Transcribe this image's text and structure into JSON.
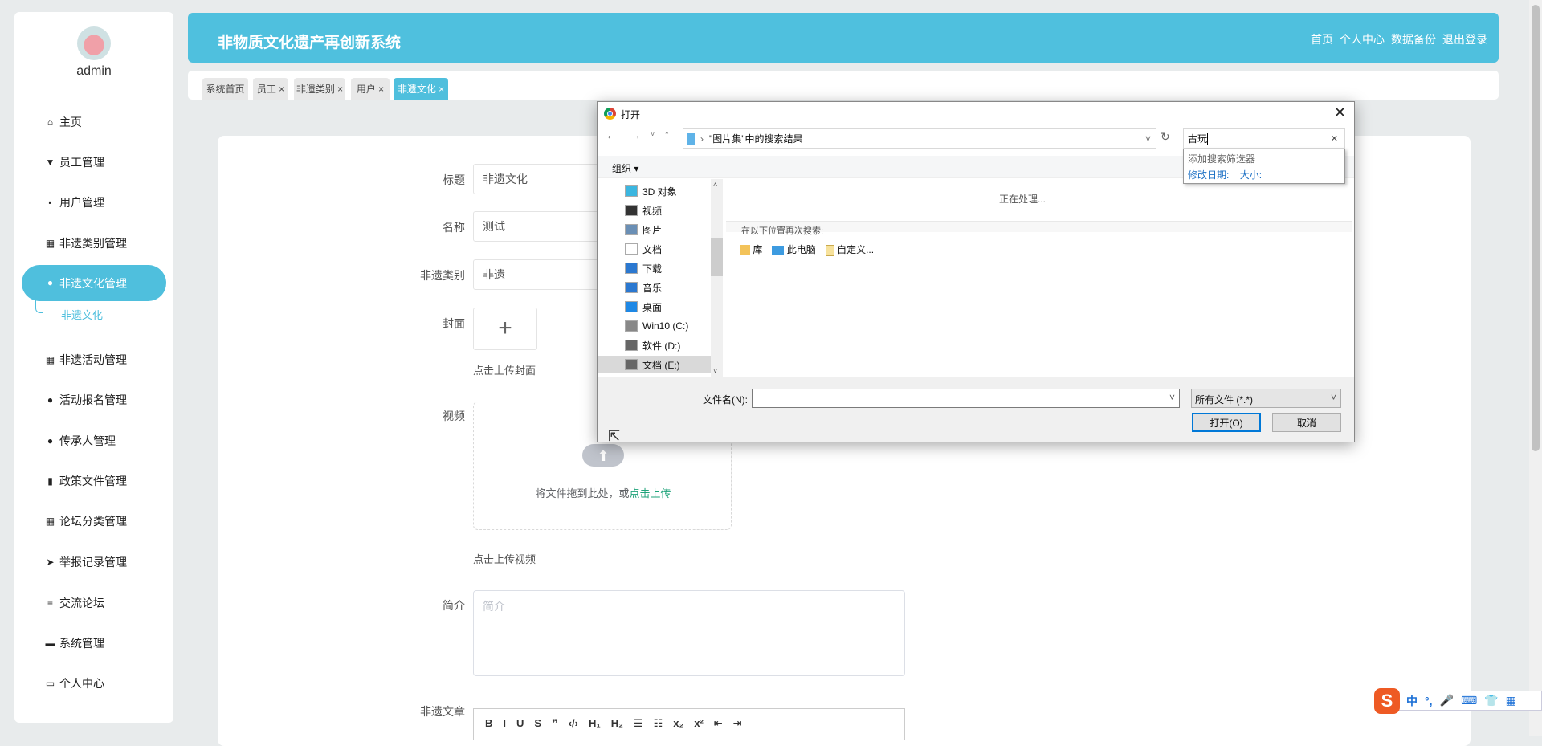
{
  "sidebar": {
    "username": "admin",
    "items": [
      {
        "label": "主页",
        "icon": "home-icon",
        "glyph": "⌂"
      },
      {
        "label": "员工管理",
        "icon": "staff-icon",
        "glyph": "▼"
      },
      {
        "label": "用户管理",
        "icon": "chat-icon",
        "glyph": "▪"
      },
      {
        "label": "非遗类别管理",
        "icon": "grid-icon",
        "glyph": "▦"
      },
      {
        "label": "非遗文化管理",
        "icon": "user-icon",
        "glyph": "●"
      },
      {
        "label": "非遗活动管理",
        "icon": "grid-icon",
        "glyph": "▦"
      },
      {
        "label": "活动报名管理",
        "icon": "person-icon",
        "glyph": "●"
      },
      {
        "label": "传承人管理",
        "icon": "bulb-icon",
        "glyph": "●"
      },
      {
        "label": "政策文件管理",
        "icon": "bar-chart-icon",
        "glyph": "▮"
      },
      {
        "label": "论坛分类管理",
        "icon": "grid-icon",
        "glyph": "▦"
      },
      {
        "label": "举报记录管理",
        "icon": "send-icon",
        "glyph": "➤"
      },
      {
        "label": "交流论坛",
        "icon": "list-icon",
        "glyph": "≡"
      },
      {
        "label": "系统管理",
        "icon": "briefcase-icon",
        "glyph": "▬"
      },
      {
        "label": "个人中心",
        "icon": "card-icon",
        "glyph": "▭"
      }
    ],
    "subitem": "非遗文化"
  },
  "header": {
    "title": "非物质文化遗产再创新系统",
    "links": [
      "首页",
      "个人中心",
      "数据备份",
      "退出登录"
    ],
    "color": "#4fc0de"
  },
  "tabs": [
    {
      "label": "系统首页"
    },
    {
      "label": "员工 ×"
    },
    {
      "label": "非遗类别 ×"
    },
    {
      "label": "用户 ×"
    },
    {
      "label": "非遗文化 ×"
    }
  ],
  "form": {
    "title_label": "标题",
    "title_value": "非遗文化",
    "name_label": "名称",
    "name_value": "测试",
    "category_label": "非遗类别",
    "category_value": "非遗",
    "cover_label": "封面",
    "cover_hint": "点击上传封面",
    "video_label": "视频",
    "video_drop": "将文件拖到此处，或",
    "video_link": "点击上传",
    "video_hint": "点击上传视频",
    "intro_label": "简介",
    "intro_placeholder": "简介",
    "article_label": "非遗文章",
    "toolbar": [
      "B",
      "I",
      "U",
      "S",
      "❞",
      "‹/›",
      "H₁",
      "H₂",
      "☰",
      "☷",
      "x₂",
      "x²",
      "⇤",
      "⇥"
    ]
  },
  "dialog": {
    "title": "打开",
    "address": "\"图片集\"中的搜索结果",
    "search_value": "古玩",
    "suggest_title": "添加搜索筛选器",
    "suggest_filters": [
      "修改日期:",
      "大小:"
    ],
    "organize": "组织 ▾",
    "nav_items": [
      "3D 对象",
      "视频",
      "图片",
      "文档",
      "下载",
      "音乐",
      "桌面",
      "Win10 (C:)",
      "软件 (D:)",
      "文档 (E:)"
    ],
    "processing": "正在处理...",
    "search_again": "在以下位置再次搜索:",
    "locations": [
      "库",
      "此电脑",
      "自定义..."
    ],
    "filename_label": "文件名(N):",
    "filename_value": "",
    "filetype": "所有文件 (*.*)",
    "open_btn": "打开(O)",
    "cancel_btn": "取消"
  },
  "ime": {
    "items": [
      "中",
      "°,",
      "🎤",
      "⌨",
      "👕",
      "▦"
    ]
  }
}
